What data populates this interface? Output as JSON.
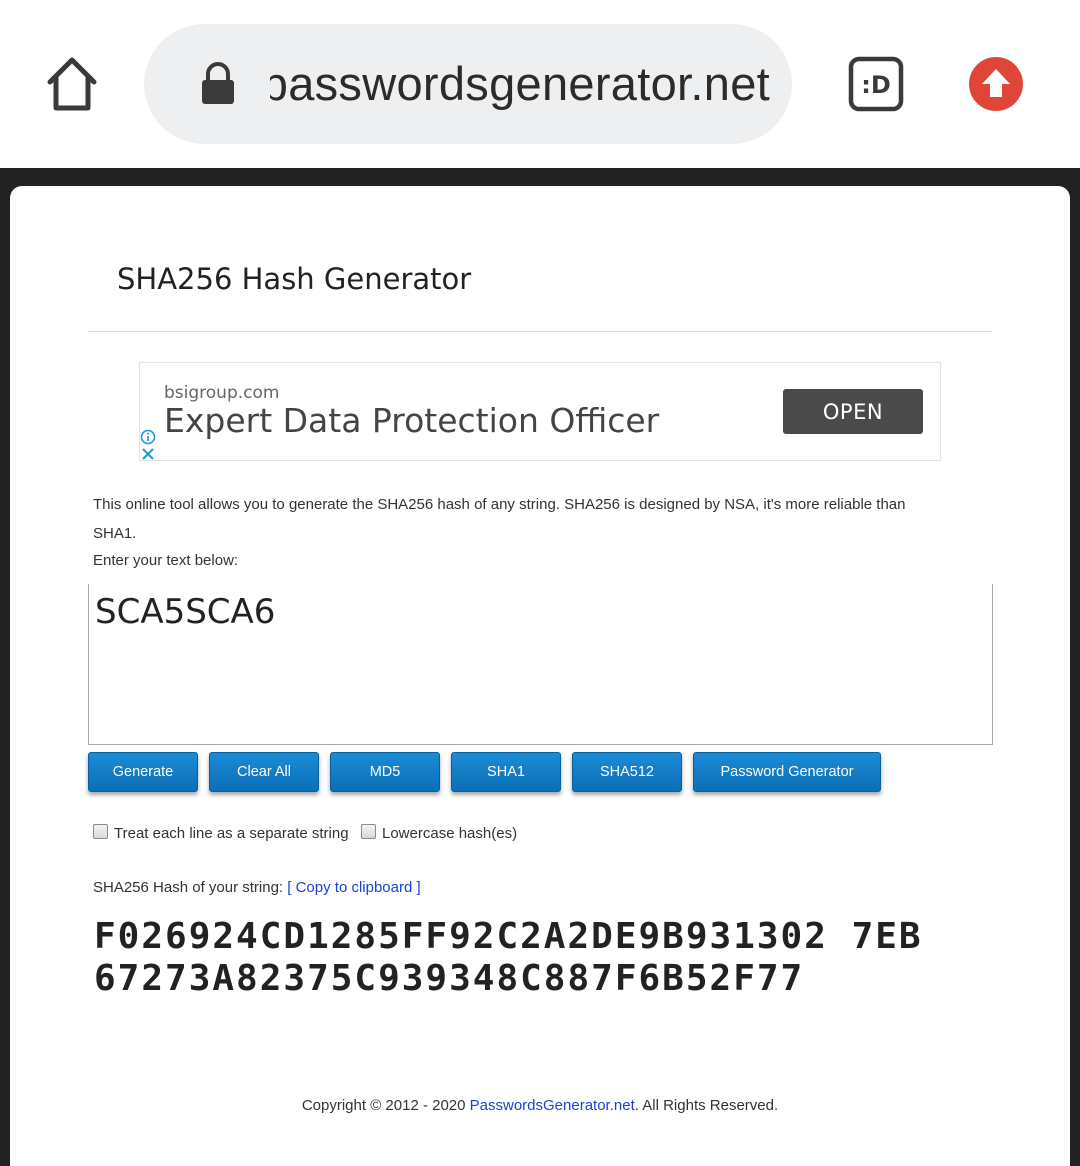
{
  "browser": {
    "url_text": "passwordsgenerator.net",
    "ext_label": ":D"
  },
  "page": {
    "title": "SHA256 Hash Generator",
    "intro_line1": "This online tool allows you to generate the SHA256 hash of any string. SHA256 is designed by NSA, it's more reliable than",
    "intro_line2": "SHA1.",
    "enter_label": "Enter your text below:",
    "input_value": "SCA5SCA6",
    "buttons": {
      "generate": "Generate",
      "clear_all": "Clear All",
      "md5": "MD5",
      "sha1": "SHA1",
      "sha512": "SHA512",
      "password_generator": "Password Generator"
    },
    "options": {
      "separate_lines": "Treat each line as a separate string",
      "lowercase": "Lowercase hash(es)"
    },
    "result_label": "SHA256 Hash of your string:",
    "copy_link": "[ Copy to clipboard ]",
    "hash_line1": "F026924CD1285FF92C2A2DE9B931302 7EB",
    "hash_line2": "67273A82375C939348C887F6B52F77",
    "footer_prefix": "Copyright © 2012 - 2020 ",
    "footer_link": "PasswordsGenerator.net",
    "footer_suffix": ". All Rights Reserved."
  },
  "ad": {
    "domain": "bsigroup.com",
    "headline": "Expert Data Protection Officer",
    "cta": "OPEN"
  },
  "colors": {
    "button_blue": "#0a6fb7",
    "link_blue": "#1d3fd6",
    "upload_red": "#e0453a"
  }
}
